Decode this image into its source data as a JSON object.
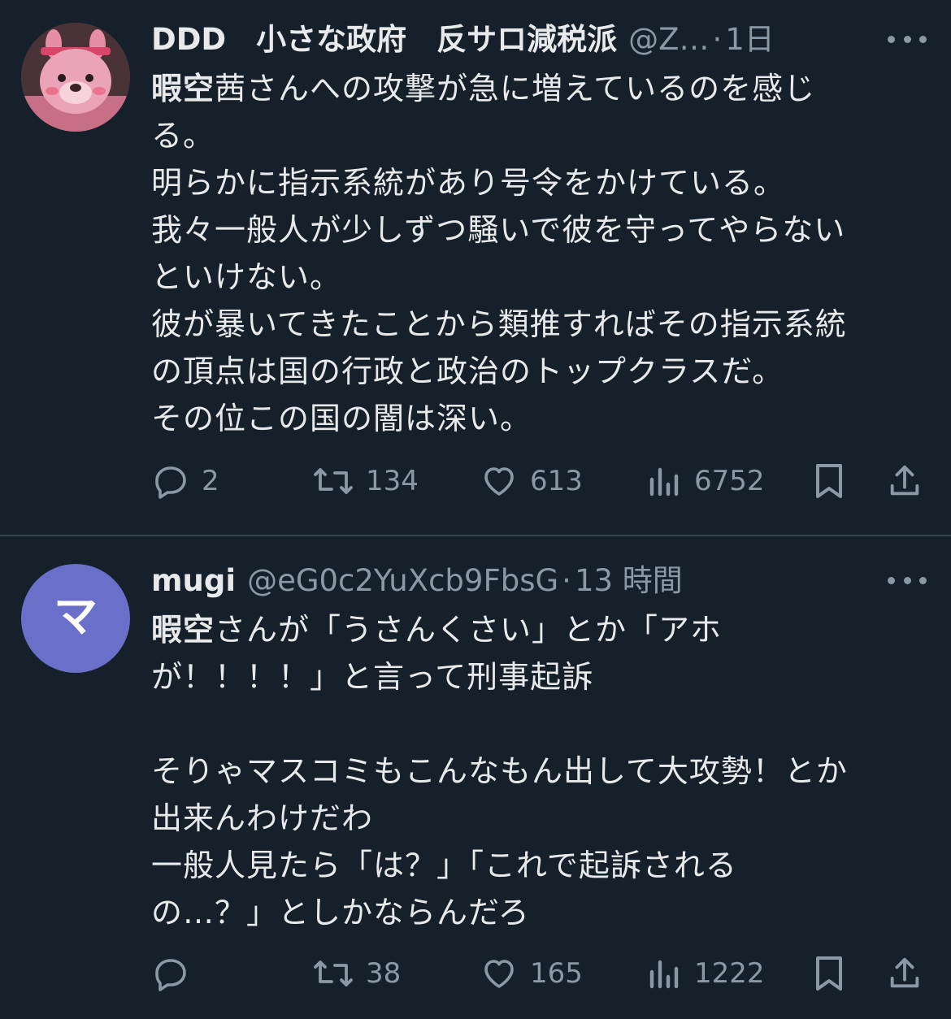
{
  "posts": [
    {
      "display_name": "DDD　小さな政府　反サロ減税派",
      "handle": "@Z…",
      "separator": "·",
      "time": "1日",
      "text_lines": [
        {
          "bold": "暇空",
          "rest": "茜さんへの攻撃が急に増えているのを感じ"
        },
        {
          "bold": "",
          "rest": "る。"
        },
        {
          "bold": "",
          "rest": "明らかに指示系統があり号令をかけている。"
        },
        {
          "bold": "",
          "rest": "我々一般人が少しずつ騒いで彼を守ってやらない"
        },
        {
          "bold": "",
          "rest": "といけない。"
        },
        {
          "bold": "",
          "rest": "彼が暴いてきたことから類推すればその指示系統"
        },
        {
          "bold": "",
          "rest": "の頂点は国の行政と政治のトップクラスだ。"
        },
        {
          "bold": "",
          "rest": "その位この国の闇は深い。"
        }
      ],
      "replies": "2",
      "reposts": "134",
      "likes": "613",
      "views": "6752"
    },
    {
      "display_name": "mugi",
      "handle": "@eG0c2YuXcb9FbsG",
      "separator": "·",
      "time": "13 時間",
      "avatar_letter": "マ",
      "text_lines": [
        {
          "bold": "暇空",
          "rest": "さんが「うさんくさい」とか「アホ"
        },
        {
          "bold": "",
          "rest": "が！！！！」と言って刑事起訴"
        },
        {
          "bold": "",
          "rest": ""
        },
        {
          "bold": "",
          "rest": "そりゃマスコミもこんなもん出して大攻勢！とか"
        },
        {
          "bold": "",
          "rest": "出来んわけだわ"
        },
        {
          "bold": "",
          "rest": "一般人見たら「は？」「これで起訴される"
        },
        {
          "bold": "",
          "rest": "の…？」としかならんだろ"
        }
      ],
      "replies": "",
      "reposts": "38",
      "likes": "165",
      "views": "1222"
    }
  ],
  "colors": {
    "background": "#15202b",
    "text": "#e7e9ea",
    "muted": "#8b98a5",
    "divider": "#38444d",
    "avatar2": "#6a6fc9"
  },
  "icons": [
    "reply-icon",
    "repost-icon",
    "like-icon",
    "views-icon",
    "bookmark-icon",
    "share-icon",
    "more-icon"
  ]
}
